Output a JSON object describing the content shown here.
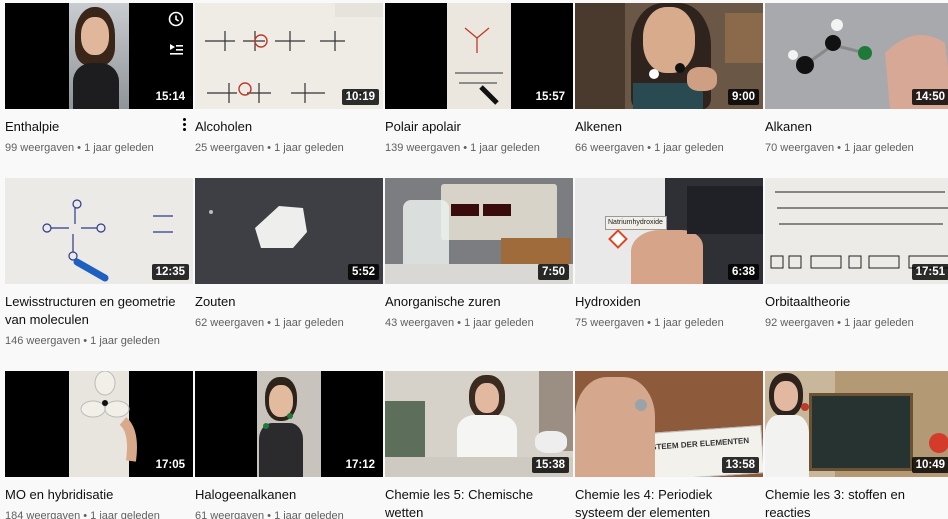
{
  "videos": [
    {
      "title": "Enthalpie",
      "meta": "99 weergaven • 1 jaar geleden",
      "duration": "15:14"
    },
    {
      "title": "Alcoholen",
      "meta": "25 weergaven • 1 jaar geleden",
      "duration": "10:19"
    },
    {
      "title": "Polair apolair",
      "meta": "139 weergaven • 1 jaar geleden",
      "duration": "15:57"
    },
    {
      "title": "Alkenen",
      "meta": "66 weergaven • 1 jaar geleden",
      "duration": "9:00"
    },
    {
      "title": "Alkanen",
      "meta": "70 weergaven • 1 jaar geleden",
      "duration": "14:50"
    },
    {
      "title": "Lewisstructuren en geometrie van moleculen",
      "meta": "146 weergaven • 1 jaar geleden",
      "duration": "12:35"
    },
    {
      "title": "Zouten",
      "meta": "62 weergaven • 1 jaar geleden",
      "duration": "5:52"
    },
    {
      "title": "Anorganische zuren",
      "meta": "43 weergaven • 1 jaar geleden",
      "duration": "7:50"
    },
    {
      "title": "Hydroxiden",
      "meta": "75 weergaven • 1 jaar geleden",
      "duration": "6:38"
    },
    {
      "title": "Orbitaaltheorie",
      "meta": "92 weergaven • 1 jaar geleden",
      "duration": "17:51"
    },
    {
      "title": "MO en hybridisatie",
      "meta": "184 weergaven • 1 jaar geleden",
      "duration": "17:05"
    },
    {
      "title": "Halogeenalkanen",
      "meta": "61 weergaven • 1 jaar geleden",
      "duration": "17:12"
    },
    {
      "title": "Chemie les 5: Chemische wetten",
      "meta": "",
      "duration": "15:38"
    },
    {
      "title": "Chemie les 4: Periodiek systeem der elementen",
      "meta": "",
      "duration": "13:58"
    },
    {
      "title": "Chemie les 3: stoffen en reacties",
      "meta": "",
      "duration": "10:49"
    }
  ],
  "thumbnail_text": {
    "natriumhydroxide_label": "Natriumhydroxide",
    "periodic_table_label": "STEEM DER ELEMENTEN"
  },
  "icons": {
    "watch_later": "clock-icon",
    "add_to_queue": "queue-icon",
    "more_actions": "kebab-menu-icon"
  }
}
